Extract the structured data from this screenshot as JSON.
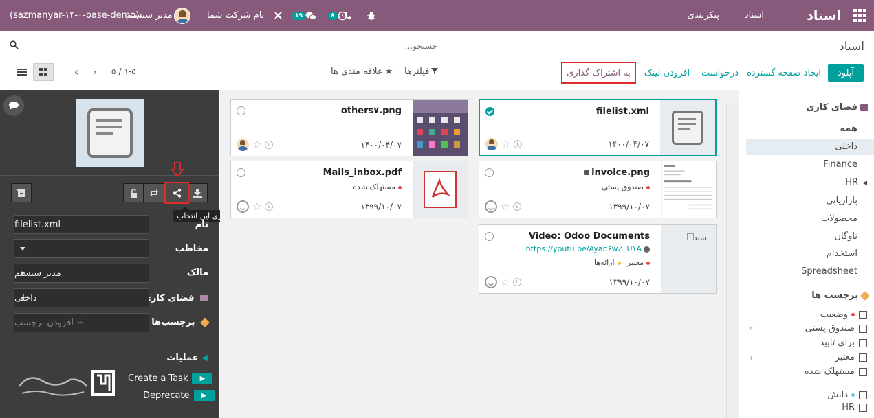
{
  "navbar": {
    "app_name": "اسناد",
    "menu": [
      "اسناد",
      "پیکربندی"
    ],
    "badge_activity": "۱۹",
    "badge_clock": "۸",
    "company": "نام شرکت شما",
    "user": "مدیر سیستم",
    "db": "(sazmanyar-۱۴-۰-base-demo)"
  },
  "breadcrumb": "اسناد",
  "search": {
    "placeholder": "جستجو..."
  },
  "buttons": {
    "upload": "آپلود",
    "spreadsheet": "ایجاد صفحه گسترده",
    "request": "درخواست",
    "add_link": "افزودن لینک",
    "share": "به اشتراک گذاری"
  },
  "filters": {
    "filters": "فیلترها",
    "favorites": "علاقه مندی ها"
  },
  "pager": {
    "range": "۱-۵",
    "sep": "/",
    "total": "۵"
  },
  "inspector": {
    "tooltip": "به اشتراک گذاری این انتخاب",
    "fields": [
      {
        "label": "نام",
        "value": "filelist.xml"
      },
      {
        "label": "مخاطب",
        "value": ""
      },
      {
        "label": "مالک",
        "value": "مدیر سیستم"
      },
      {
        "label": "فضای کاری",
        "value": "داخلی"
      },
      {
        "label": "برچسب‌ها",
        "value": "+ افزودن برچسب"
      }
    ],
    "actions_title": "عملیات",
    "actions": [
      "Create a Task",
      "Deprecate"
    ]
  },
  "cards": [
    {
      "title": "filelist.xml",
      "date": "۱۴۰۰/۰۴/۰۷"
    },
    {
      "title": "others۷.png",
      "date": "۱۴۰۰/۰۴/۰۷"
    },
    {
      "title": "invoice.png",
      "tag": "صندوق پستی",
      "date": "۱۳۹۹/۱۰/۰۷",
      "thumb_text": "INV/2021/0001"
    },
    {
      "title": "Mails_inbox.pdf",
      "tag": "مستهلک شده",
      "date": "۱۳۹۹/۱۰/۰۷"
    },
    {
      "title": "Video: Odoo Documents",
      "url": "https://youtu.be/Ayab۶wZ_U۱A",
      "tag": "ارائه‌ها",
      "tag2": "معتبر",
      "date": "۱۳۹۹/۱۰/۰۷",
      "thumb_text": "سند"
    }
  ],
  "sidebar": {
    "workspace_title": "فضای کاری",
    "workspaces": [
      "همه",
      "داخلی",
      "Finance",
      "HR",
      "بازاریابی",
      "محصولات",
      "ناوگان",
      "استخدام",
      "Spreadsheet"
    ],
    "tags_title": "برچسب ها",
    "status_title": "وضعیت",
    "status_items": [
      {
        "label": "صندوق پستی",
        "count": "۲"
      },
      {
        "label": "برای تایید",
        "count": ""
      },
      {
        "label": "معتبر",
        "count": "۱"
      },
      {
        "label": "مستهلک شده",
        "count": ""
      }
    ],
    "knowledge_title": "دانش",
    "knowledge_items": [
      "HR"
    ]
  },
  "colors": {
    "brand": "#875a7b",
    "accent": "#00a09d",
    "highlight": "#dd2c2c"
  }
}
